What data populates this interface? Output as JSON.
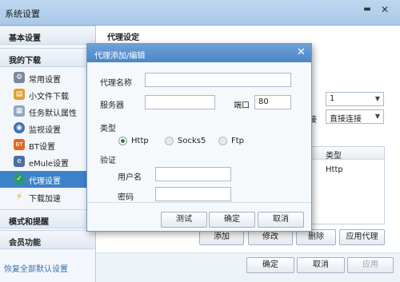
{
  "window": {
    "title": "系统设置",
    "minimize_glyph": "▬",
    "close_glyph": "✕"
  },
  "sidebar": {
    "sections": {
      "basic": "基本设置",
      "downloads": "我的下载",
      "mode": "模式和提醒",
      "member": "会员功能"
    },
    "items": [
      {
        "label": "常用设置",
        "icon": "gear-icon"
      },
      {
        "label": "小文件下载",
        "icon": "file-icon"
      },
      {
        "label": "任务默认属性",
        "icon": "task-icon"
      },
      {
        "label": "监视设置",
        "icon": "monitor-icon"
      },
      {
        "label": "BT设置",
        "icon": "bt-icon"
      },
      {
        "label": "eMule设置",
        "icon": "emule-icon"
      },
      {
        "label": "代理设置",
        "icon": "proxy-icon"
      },
      {
        "label": "下载加速",
        "icon": "lightning-icon"
      }
    ],
    "restore_link": "恢复全部默认设置"
  },
  "main": {
    "title": "代理设定",
    "top_select_value": "1",
    "connect_label": "接",
    "connect_select_value": "直接连接",
    "list": {
      "column_type": "类型",
      "rows": [
        {
          "type": "Http"
        }
      ]
    },
    "buttons": {
      "add": "添加",
      "modify": "修改",
      "delete": "删除",
      "apply_proxy": "应用代理"
    }
  },
  "footer": {
    "ok": "确定",
    "cancel": "取消",
    "apply": "应用"
  },
  "dialog": {
    "title": "代理添加/编辑",
    "close_glyph": "✕",
    "proxy_name_label": "代理名称",
    "proxy_name_value": "",
    "server_label": "服务器",
    "server_value": "",
    "port_label": "端口",
    "port_value": "80",
    "type_label": "类型",
    "types": {
      "http": "Http",
      "socks5": "Socks5",
      "ftp": "Ftp"
    },
    "auth_label": "验证",
    "username_label": "用户名",
    "username_value": "",
    "password_label": "密码",
    "password_value": "",
    "buttons": {
      "test": "测试",
      "ok": "确定",
      "cancel": "取消"
    }
  }
}
